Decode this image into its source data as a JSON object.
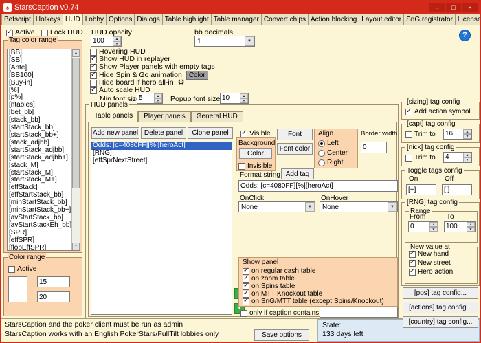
{
  "titlebar": {
    "title": "StarsCaption v0.74"
  },
  "icons": {
    "app": "♠",
    "minimize": "–",
    "maximize": "□",
    "close": "×",
    "help": "?",
    "gear": "⚙",
    "arrow_up": "▲",
    "arrow_down": "▼"
  },
  "tabs": {
    "items": [
      "Betscript",
      "Hotkeys",
      "HUD",
      "Lobby",
      "Options",
      "Dialogs",
      "Table highlight",
      "Table manager",
      "Convert chips",
      "Action blocking",
      "Layout editor",
      "SnG registrator",
      "License"
    ],
    "active": "HUD"
  },
  "left": {
    "active": {
      "label": "Active",
      "checked": true
    },
    "lock": {
      "label": "Lock HUD",
      "checked": false
    },
    "tag_color_range": {
      "title": "Tag color range",
      "items": [
        "[BB]",
        "[SB]",
        "[Ante]",
        "[BB100]",
        "[Buy-in]",
        "[%]",
        "[p%]",
        "[ntables]",
        "[bet_bb]",
        "[stack_bb]",
        "[startStack_bb]",
        "[startStack_bb+]",
        "[stack_adjbb]",
        "[startStack_adjbb]",
        "[startStack_adjbb+]",
        "[stack_M]",
        "[startStack_M]",
        "[startStack_M+]",
        "[effStack]",
        "[effStartStack_bb]",
        "[minStartStack_bb]",
        "[minStartStack_bb+]",
        "[avStartStack_bb]",
        "[avStartStackEh_bb]",
        "[SPR]",
        "[effSPR]",
        "[flopEffSPR]"
      ]
    },
    "color_range": {
      "title": "Color range",
      "active_label": "Active",
      "active_checked": false,
      "value1": "15",
      "value2": "20"
    }
  },
  "settings": {
    "hud_opacity": {
      "label": "HUD opacity",
      "value": "100"
    },
    "bb_decimals": {
      "label": "bb decimals",
      "value": "1"
    },
    "options": [
      {
        "label": "Hovering HUD",
        "checked": false
      },
      {
        "label": "Show HUD in replayer",
        "checked": true
      },
      {
        "label": "Show Player panels with empty tags",
        "checked": true
      },
      {
        "label": "Hide Spin & Go animation",
        "checked": true,
        "extra": "Color"
      },
      {
        "label": "Hide board if hero all-in",
        "checked": false
      },
      {
        "label": "Auto scale HUD",
        "checked": true
      }
    ],
    "min_font_size": {
      "label": "Min font size",
      "value": "5"
    },
    "popup_font_size": {
      "label": "Popup font size",
      "value": "10"
    }
  },
  "hud_panels": {
    "title": "HUD panels",
    "tabs": [
      "Table panels",
      "Player panels",
      "General HUD"
    ],
    "buttons": {
      "add": "Add new panel",
      "delete": "Delete panel",
      "clone": "Clone panel"
    },
    "panels": [
      {
        "label": "Odds: [c=4080FF][%][heroAct]",
        "selected": true
      },
      {
        "label": "[RNG]",
        "selected": false
      },
      {
        "label": "[effSprNextStreet]",
        "selected": false
      }
    ],
    "visible": {
      "label": "Visible",
      "checked": true
    },
    "invisible": {
      "label": "Invisible",
      "checked": false
    },
    "background_label": "Background",
    "color_button": "Color",
    "font_button": "Font",
    "font_color_button": "Font color",
    "align": {
      "title": "Align",
      "options": [
        {
          "label": "Left",
          "selected": true
        },
        {
          "label": "Center",
          "selected": false
        },
        {
          "label": "Right",
          "selected": false
        }
      ]
    },
    "border_width": {
      "label": "Border width",
      "value": "0"
    },
    "format_string": {
      "label": "Format string",
      "add_tag": "Add tag",
      "value": "Odds: [c=4080FF][%][heroAct]"
    },
    "onclick": {
      "label": "OnClick",
      "value": "None"
    },
    "onhover": {
      "label": "OnHover",
      "value": "None"
    },
    "show_panel": {
      "title": "Show panel",
      "options": [
        {
          "label": "on regular cash table",
          "checked": true
        },
        {
          "label": "on zoom table",
          "checked": true
        },
        {
          "label": "on Spins table",
          "checked": true
        },
        {
          "label": "on MTT Knockout table",
          "checked": true
        },
        {
          "label": "on SnG/MTT table (except Spins/Knockout)",
          "checked": true
        }
      ]
    },
    "caption_filter": {
      "label": "only if caption contains",
      "checked": false,
      "value": ""
    }
  },
  "tag_configs": {
    "sizing": {
      "title": "[sizing] tag config",
      "option": {
        "label": "Add action symbol",
        "checked": true
      }
    },
    "capt": {
      "title": "[capt] tag config",
      "trim": {
        "label": "Trim to",
        "checked": false,
        "value": "16"
      }
    },
    "nick": {
      "title": "[nick] tag config",
      "trim": {
        "label": "Trim to",
        "checked": false,
        "value": "4"
      }
    },
    "toggle": {
      "title": "Toggle tags config",
      "on_label": "On",
      "off_label": "Off",
      "on_value": "[+]",
      "off_value": "[ ]"
    },
    "rng": {
      "title": "[RNG] tag config",
      "range": {
        "title": "Range",
        "from_label": "From",
        "to_label": "To",
        "from_value": "0",
        "to_value": "100"
      },
      "new_value": {
        "title": "New value at",
        "options": [
          {
            "label": "New hand",
            "checked": true
          },
          {
            "label": "New street",
            "checked": true
          },
          {
            "label": "Hero action",
            "checked": true
          }
        ]
      }
    },
    "buttons": [
      "[pos] tag config...",
      "[actions] tag config...",
      "[country] tag config..."
    ]
  },
  "statusbar": {
    "line1": "StarsCaption and the poker client must be run as admin",
    "line2": "StarsCaption works with an English PokerStars/FullTilt lobbies only",
    "save_button": "Save options",
    "state_label": "State:",
    "state_value": "133 days left"
  },
  "colors": {
    "titlebar": "#d42a1a",
    "panel_peach": "#fad5b0",
    "selection_blue": "#3163c5",
    "window_bg": "#fcf5d6",
    "state_panel": "#dde9f4",
    "green_button": "#3fae49"
  }
}
